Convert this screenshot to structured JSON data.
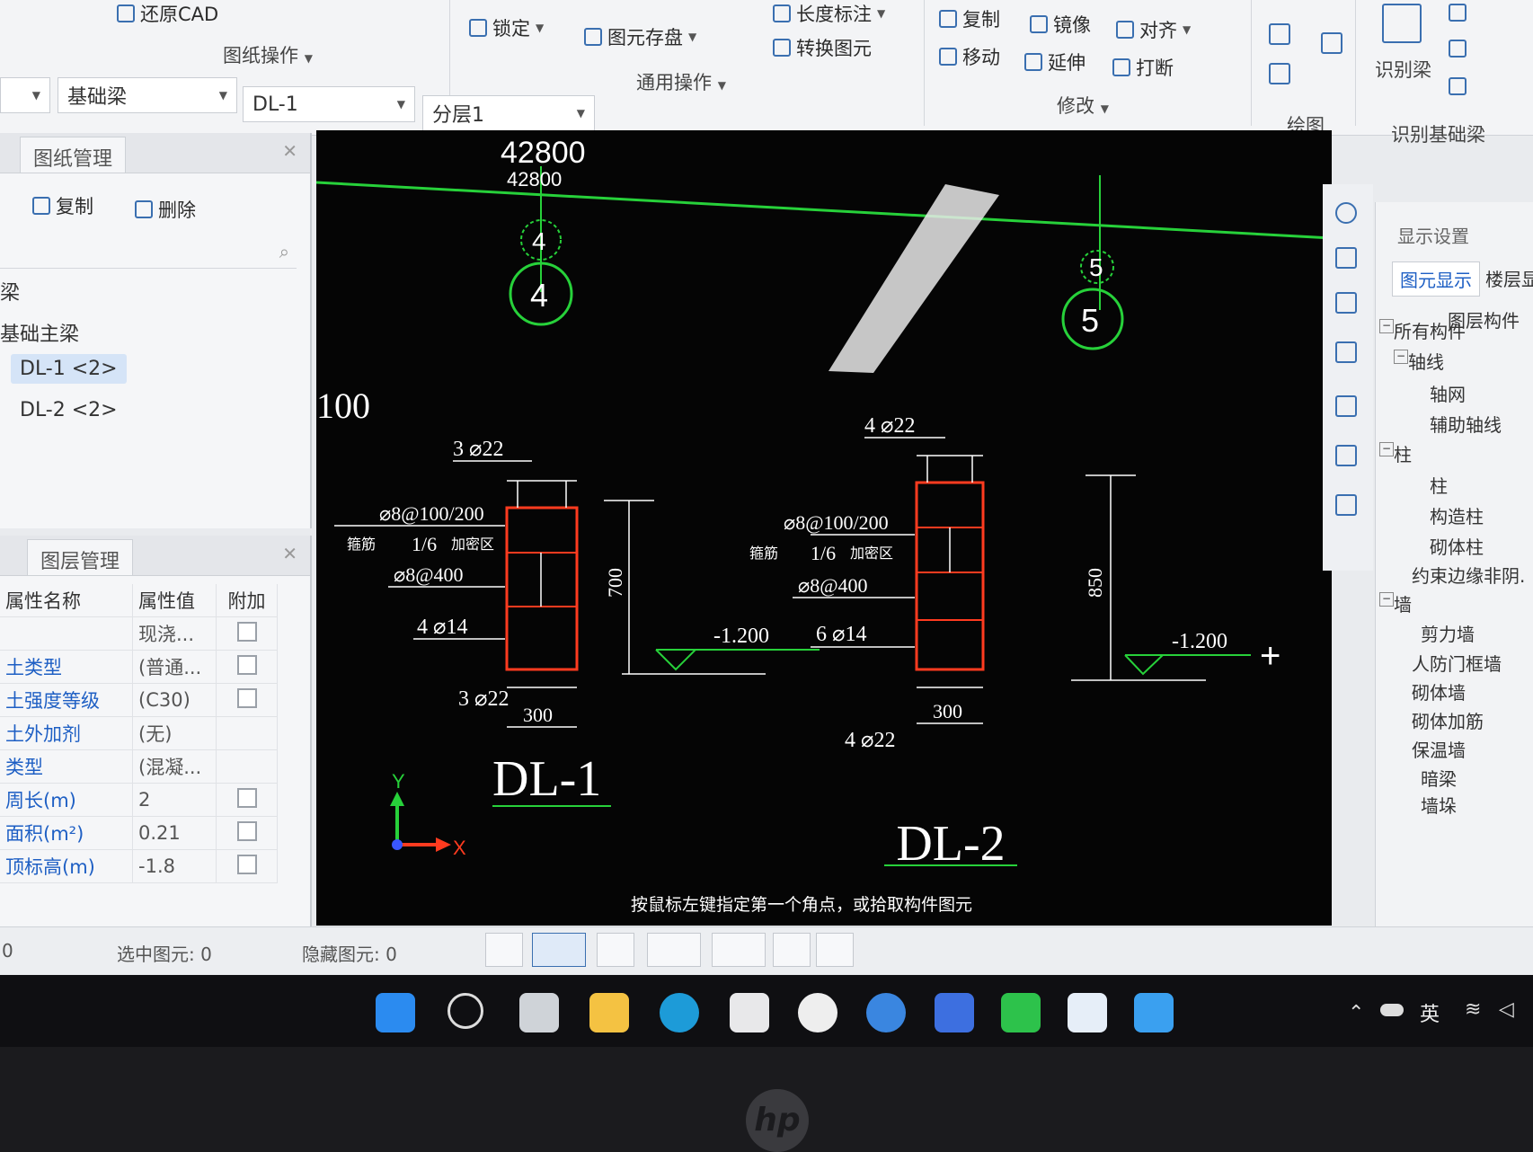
{
  "ribbon": {
    "restore_cad": "还原CAD",
    "drawing_ops": "图纸操作",
    "lock": "锁定",
    "save_element": "图元存盘",
    "length_dim": "长度标注",
    "convert_element": "转换图元",
    "general_ops": "通用操作",
    "copy": "复制",
    "mirror": "镜像",
    "align": "对齐",
    "move": "移动",
    "extend": "延伸",
    "break": "打断",
    "modify": "修改",
    "draw": "绘图",
    "identify_beam": "识别梁",
    "identify_foundation_beam": "识别基础梁"
  },
  "selectbar": {
    "type": "基础梁",
    "name": "DL-1",
    "layer": "分层1"
  },
  "drawing_panel": {
    "tab": "图纸管理",
    "copy": "复制",
    "delete": "删除",
    "tree": [
      "梁",
      "基础主梁",
      "DL-1 <2>",
      "DL-2 <2>"
    ]
  },
  "props_panel": {
    "tab": "图层管理",
    "headers": [
      "属性名称",
      "属性值",
      "附加"
    ],
    "rows": [
      {
        "name": "",
        "value": "现浇...",
        "check": true
      },
      {
        "name": "土类型",
        "value": "(普通...",
        "check": true
      },
      {
        "name": "土强度等级",
        "value": "(C30)",
        "check": true
      },
      {
        "name": "土外加剂",
        "value": "(无)",
        "check": false
      },
      {
        "name": "类型",
        "value": "(混凝...",
        "check": false
      },
      {
        "name": "周长(m)",
        "value": "2",
        "check": true
      },
      {
        "name": "面积(m²)",
        "value": "0.21",
        "check": true
      },
      {
        "name": "顶标高(m)",
        "value": "-1.8",
        "check": true
      }
    ]
  },
  "canvas": {
    "dim_total": "42800",
    "dim_total_small": "42800",
    "axis_4": "4",
    "axis_5": "5",
    "left_label": "100",
    "dl1": {
      "title": "DL-1",
      "top_rebar": "3 ⌀22",
      "stirrup": "⌀8@100/200",
      "stirrup_note_left": "箍筋",
      "stirrup_ratio": "1/6",
      "stirrup_note_right": "加密区",
      "waist_stirrup": "⌀8@400",
      "side_rebar": "4 ⌀14",
      "bottom_rebar": "3 ⌀22",
      "height": "700",
      "width": "300",
      "elevation": "-1.200"
    },
    "dl2": {
      "title": "DL-2",
      "top_rebar": "4 ⌀22",
      "stirrup": "⌀8@100/200",
      "stirrup_note_left": "箍筋",
      "stirrup_ratio": "1/6",
      "stirrup_note_right": "加密区",
      "waist_stirrup": "⌀8@400",
      "side_rebar": "6 ⌀14",
      "bottom_rebar": "4 ⌀22",
      "height": "850",
      "width": "300",
      "elevation": "-1.200"
    },
    "hint": "按鼠标左键指定第一个角点，或拾取构件图元",
    "axis_x": "X",
    "axis_y": "Y"
  },
  "right_panel": {
    "title": "显示设置",
    "tab_active": "图元显示",
    "tab_other": "楼层显",
    "header": "图层构件",
    "items": [
      "所有构件",
      "轴线",
      "轴网",
      "辅助轴线",
      "柱",
      "柱",
      "构造柱",
      "砌体柱",
      "约束边缘非阴.",
      "墙",
      "剪力墙",
      "人防门框墙",
      "砌体墙",
      "砌体加筋",
      "保温墙",
      "暗梁",
      "墙垛"
    ]
  },
  "status": {
    "left": "0",
    "selected": "选中图元: 0",
    "hidden": "隐藏图元: 0"
  },
  "taskbar": {
    "lang": "英"
  },
  "colors": {
    "canvas_bg": "#050505",
    "green_line": "#27d13a",
    "rebar_red": "#ff3b1f",
    "accent_blue": "#1e5fc4"
  }
}
